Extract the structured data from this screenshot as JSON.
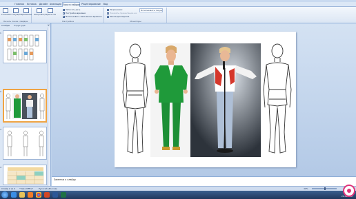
{
  "ribbon": {
    "tabs": [
      "Главная",
      "Вставка",
      "Дизайн",
      "Анимация",
      "Показ слайдов",
      "Рецензирование",
      "Вид"
    ],
    "active_tab": "Показ слайдов",
    "groups": {
      "slide_show_start": {
        "label": "Начать показ слайдов",
        "buttons": [
          "С начала",
          "С текущего слайда",
          "Произвольный показ"
        ]
      },
      "setup": {
        "label": "Настройка",
        "buttons": [
          "Настройка демонстрации",
          "Скрыть слайд"
        ],
        "options": [
          {
            "label": "Записать речь",
            "enabled": true
          },
          {
            "label": "Настройка времени",
            "enabled": true
          },
          {
            "label": "Использовать записанные времена",
            "enabled": true
          }
        ]
      },
      "monitors": {
        "label": "Мониторы",
        "resolution_label": "Разрешение:",
        "resolution_value": "Использовать текущее",
        "options": [
          {
            "label": "Показать презентацию на:",
            "enabled": false
          },
          {
            "label": "Режим докладчика",
            "enabled": true
          }
        ]
      }
    }
  },
  "left_panel": {
    "tabs": [
      "Слайды",
      "Структура"
    ],
    "close_icon": "close-icon",
    "slides": [
      {
        "number": "1",
        "selected": false
      },
      {
        "number": "2",
        "selected": true
      },
      {
        "number": "3",
        "selected": false
      },
      {
        "number": "4",
        "selected": false
      }
    ]
  },
  "notes": {
    "placeholder": "Заметки к слайду"
  },
  "status": {
    "slide_info": "Слайд 2 из 4",
    "theme": "\"Тема Office\"",
    "language": "Русский (Россия)",
    "zoom": "49%"
  },
  "taskbar": {
    "icons": [
      "ie-icon",
      "folder-icon",
      "media-icon",
      "chrome-icon",
      "powerpoint-icon",
      "word-icon",
      "excel-icon"
    ],
    "time": "12:38",
    "date": "20.01.2017"
  }
}
